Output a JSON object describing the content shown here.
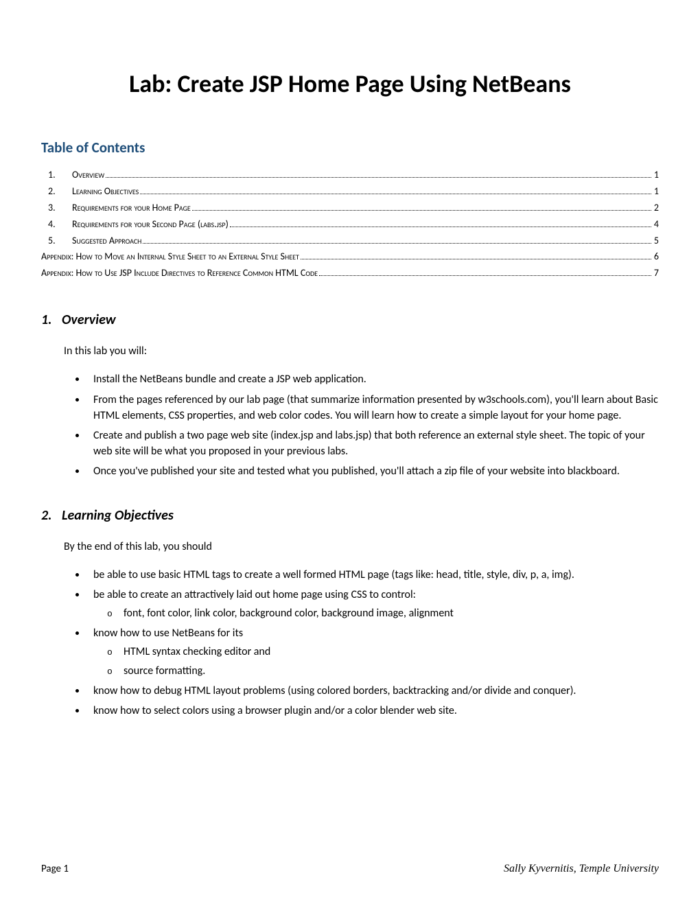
{
  "title": "Lab: Create JSP Home Page Using NetBeans",
  "toc": {
    "heading": "Table of Contents",
    "items": [
      {
        "num": "1.",
        "label": "Overview",
        "page": "1",
        "appendix": false
      },
      {
        "num": "2.",
        "label": "Learning Objectives",
        "page": "1",
        "appendix": false
      },
      {
        "num": "3.",
        "label": "Requirements for your Home Page",
        "page": "2",
        "appendix": false
      },
      {
        "num": "4.",
        "label": "Requirements for your Second Page (labs.jsp)",
        "page": "4",
        "appendix": false
      },
      {
        "num": "5.",
        "label": "Suggested Approach",
        "page": "5",
        "appendix": false
      },
      {
        "num": "",
        "label": "Appendix: How to Move an Internal Style Sheet to an External Style Sheet",
        "page": "6",
        "appendix": true
      },
      {
        "num": "",
        "label": "Appendix: How to Use JSP Include Directives to Reference Common HTML Code",
        "page": "7",
        "appendix": true
      }
    ]
  },
  "sections": [
    {
      "num": "1.",
      "heading": "Overview",
      "intro": "In this lab you will:",
      "bullets": [
        {
          "text": "Install the NetBeans bundle and create a JSP web application."
        },
        {
          "text": "From the pages referenced by our lab page (that summarize information presented by w3schools.com), you'll learn about Basic HTML elements, CSS properties, and web color codes. You will learn how to create a simple layout for your home page."
        },
        {
          "text": "Create and publish a two page web site (index.jsp and labs.jsp) that both reference an external style sheet. The topic of your web site will be what you proposed in your previous labs."
        },
        {
          "text": "Once you've published your site and tested what you published, you'll attach a zip file of your website into blackboard."
        }
      ]
    },
    {
      "num": "2.",
      "heading": "Learning Objectives",
      "intro": "By the end of this lab, you should",
      "bullets": [
        {
          "text": "be able to use basic HTML tags to create a well formed HTML page (tags like: head, title, style, div, p, a, img)."
        },
        {
          "text": "be able to create an attractively laid out home page using CSS to control:",
          "sub": [
            "font, font color, link color, background color, background image, alignment"
          ]
        },
        {
          "text": "know how to use NetBeans for its",
          "sub": [
            "HTML syntax checking editor and",
            "source formatting."
          ]
        },
        {
          "text": "know how to debug HTML layout problems (using colored borders, backtracking and/or divide and conquer)."
        },
        {
          "text": "know how to select colors using a browser plugin and/or a color blender web site."
        }
      ]
    }
  ],
  "footer": {
    "left": "Page 1",
    "right": "Sally Kyvernitis, Temple University"
  }
}
